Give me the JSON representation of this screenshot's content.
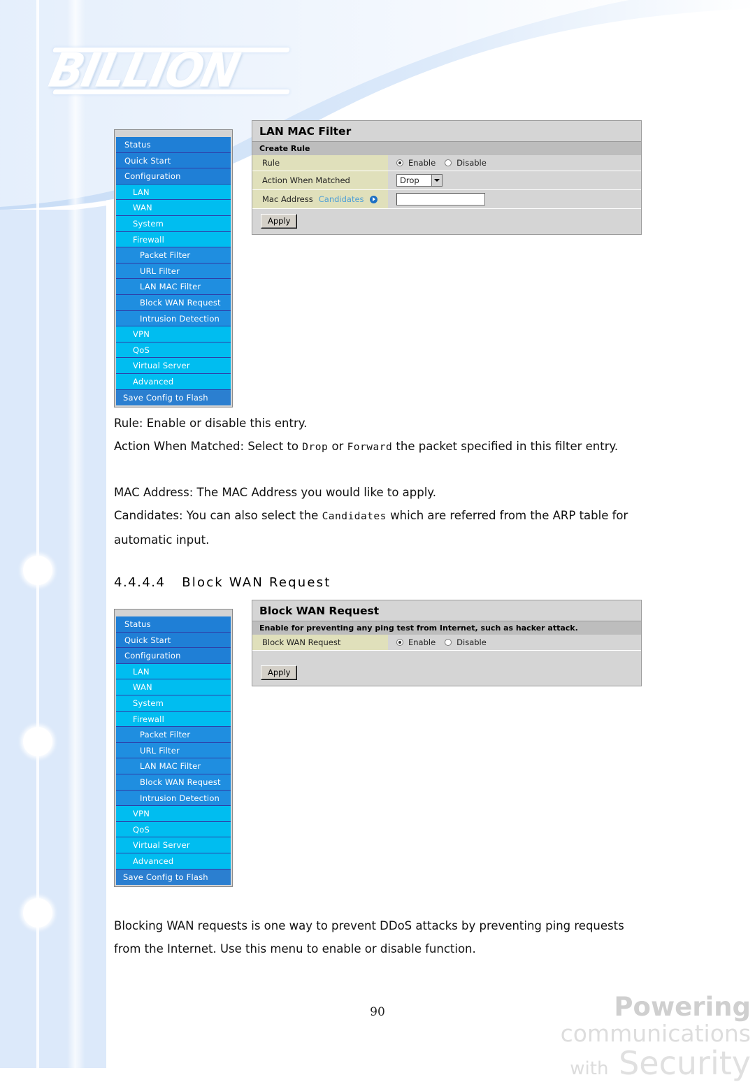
{
  "brand": {
    "logo_text": "BILLION",
    "footer_line1_bold": "Powering",
    "footer_line1_light": "communications",
    "footer_line2_light": "with",
    "footer_line2_bold": "Security"
  },
  "page_number": "90",
  "sidebar": {
    "items": [
      {
        "label": "Status",
        "level": 1
      },
      {
        "label": "Quick Start",
        "level": 1
      },
      {
        "label": "Configuration",
        "level": 1
      },
      {
        "label": "LAN",
        "level": 2
      },
      {
        "label": "WAN",
        "level": 2
      },
      {
        "label": "System",
        "level": 2
      },
      {
        "label": "Firewall",
        "level": 2
      },
      {
        "label": "Packet Filter",
        "level": 3
      },
      {
        "label": "URL Filter",
        "level": 3
      },
      {
        "label": "LAN MAC Filter",
        "level": 3
      },
      {
        "label": "Block WAN Request",
        "level": 3
      },
      {
        "label": "Intrusion Detection",
        "level": 3
      },
      {
        "label": "VPN",
        "level": 2
      },
      {
        "label": "QoS",
        "level": 2
      },
      {
        "label": "Virtual Server",
        "level": 2
      },
      {
        "label": "Advanced",
        "level": 2
      },
      {
        "label": "Save Config to Flash",
        "level": 0
      }
    ]
  },
  "panel_lan_mac_filter": {
    "title": "LAN MAC Filter",
    "subtitle": "Create Rule",
    "rows": {
      "rule_label": "Rule",
      "rule_enable": "Enable",
      "rule_disable": "Disable",
      "rule_selected": "Enable",
      "action_label": "Action When Matched",
      "action_value": "Drop",
      "action_options": "Drop, Forward",
      "mac_label": "Mac Address",
      "mac_candidates_link": "Candidates",
      "mac_value": ""
    },
    "apply_label": "Apply"
  },
  "panel_block_wan_request": {
    "title": "Block WAN Request",
    "subtitle": "Enable for preventing any ping test from Internet, such as hacker attack.",
    "rows": {
      "label": "Block WAN Request",
      "enable": "Enable",
      "disable": "Disable",
      "selected": "Enable"
    },
    "apply_label": "Apply"
  },
  "body_text": {
    "p1": "Rule: Enable or disable this entry.",
    "p2_a": "Action When Matched: Select to ",
    "p2_mono1": "Drop",
    "p2_b": " or ",
    "p2_mono2": "Forward",
    "p2_c": " the packet specified in this filter entry.",
    "p3": "MAC Address: The MAC Address you would like to apply.",
    "p4_a": "Candidates: You can also select the ",
    "p4_mono": "Candidates",
    "p4_b": " which are referred from the ARP table for automatic input.",
    "heading_num": "4.4.4.4",
    "heading_text": "Block WAN Request",
    "p5": "Blocking WAN requests is one way to prevent DDoS attacks by preventing ping requests from the Internet. Use this menu to enable or disable function."
  },
  "colors": {
    "nav_level1": "#1f7fd6",
    "nav_level2": "#00bdf0",
    "nav_level3": "#1f8ee0",
    "panel_title_bg": "#d5d5d5",
    "panel_sub_bg": "#bdbdbd",
    "field_label_bg": "#e0e0bb",
    "link": "#4e9fd6",
    "page_band": "#dce9fa"
  }
}
